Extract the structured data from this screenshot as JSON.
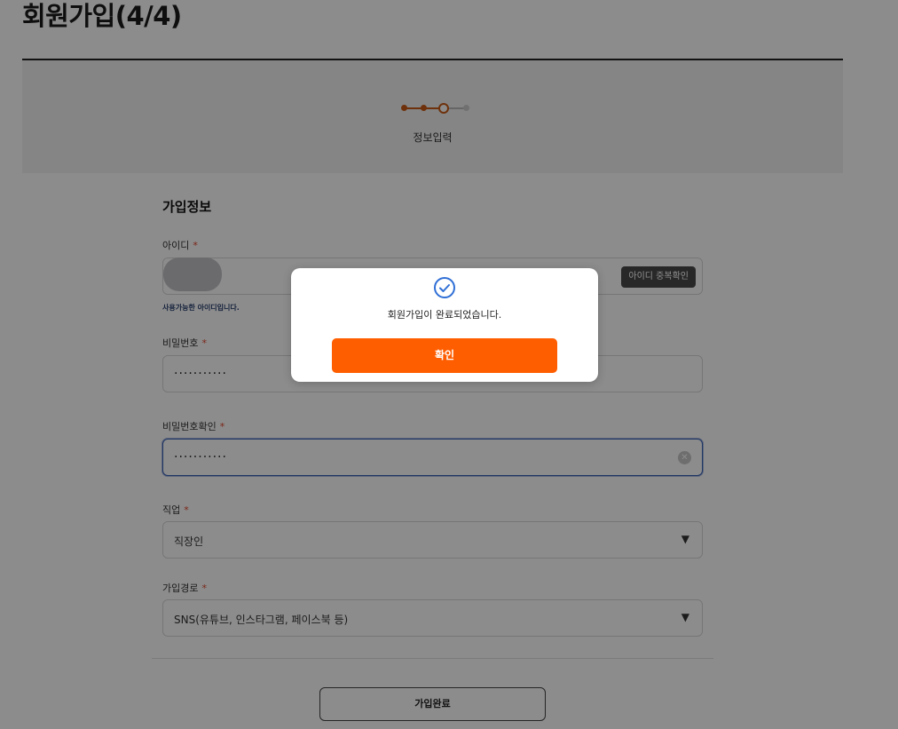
{
  "page": {
    "title": "회원가입(4/4)",
    "step_label": "정보입력"
  },
  "form": {
    "section_title": "가입정보",
    "required_mark": "*",
    "id_field": {
      "label": "아이디",
      "check_button": "아이디 중복확인",
      "helper": "사용가능한 아이디입니다."
    },
    "password_field": {
      "label": "비밀번호",
      "value": "···········"
    },
    "password_confirm_field": {
      "label": "비밀번호확인",
      "value": "···········"
    },
    "job_field": {
      "label": "직업",
      "selected": "직장인"
    },
    "path_field": {
      "label": "가입경로",
      "selected": "SNS(유튜브, 인스타그램, 페이스북 등)"
    },
    "submit_label": "가입완료"
  },
  "modal": {
    "message": "회원가입이 완료되었습니다.",
    "confirm_label": "확인"
  },
  "colors": {
    "accent": "#ff5e00",
    "step_active": "#c95a14",
    "check_icon": "#2f6fd6",
    "required": "#e0442b"
  },
  "icons": {
    "check": "check-circle-icon",
    "clear": "clear-circle-icon",
    "dropdown": "caret-down-icon"
  }
}
